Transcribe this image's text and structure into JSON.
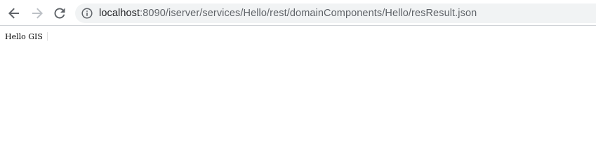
{
  "browser": {
    "address_bar": {
      "host": "localhost",
      "rest": ":8090/iserver/services/Hello/rest/domainComponents/Hello/resResult.json",
      "site_info_icon": "info-circle-icon"
    },
    "nav": {
      "back_icon": "arrow-left-icon",
      "forward_icon": "arrow-right-icon",
      "reload_icon": "reload-icon"
    }
  },
  "page": {
    "body_text": "Hello GIS"
  },
  "colors": {
    "toolbar_bg": "#ffffff",
    "omnibox_bg": "#f1f3f4",
    "icon_active": "#5f6368",
    "icon_disabled": "#bdc1c6",
    "divider": "#cfd2d6"
  }
}
